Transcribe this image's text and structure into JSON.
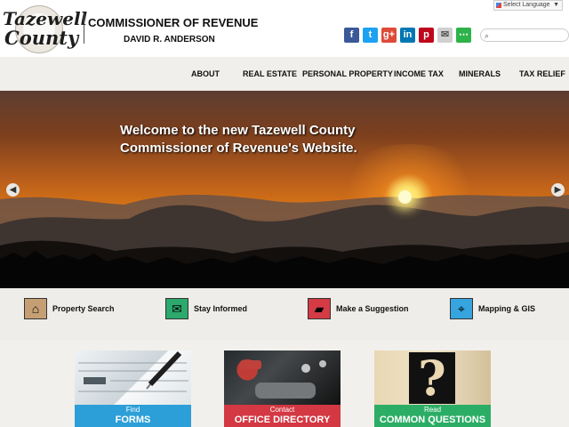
{
  "header": {
    "logo_line1": "Tazewell",
    "logo_line2": "County",
    "title": "COMMISSIONER OF REVENUE",
    "subtitle": "DAVID R. ANDERSON",
    "language_selector": "Select Language",
    "language_arrow": "▼",
    "social": [
      {
        "icon": "facebook-icon",
        "glyph": "f",
        "color": "#3b5998"
      },
      {
        "icon": "twitter-icon",
        "glyph": "t",
        "color": "#1da1f2"
      },
      {
        "icon": "google-plus-icon",
        "glyph": "g+",
        "color": "#dd4b39"
      },
      {
        "icon": "linkedin-icon",
        "glyph": "in",
        "color": "#0077b5"
      },
      {
        "icon": "pinterest-icon",
        "glyph": "p",
        "color": "#bd081c"
      },
      {
        "icon": "email-icon",
        "glyph": "✉",
        "color": "#d0d0d0"
      },
      {
        "icon": "share-icon",
        "glyph": "⋯",
        "color": "#2db34a"
      }
    ],
    "search_placeholder": "",
    "search_icon": "⌕"
  },
  "nav": {
    "items": [
      "ABOUT",
      "REAL ESTATE",
      "PERSONAL PROPERTY",
      "INCOME TAX",
      "MINERALS",
      "TAX RELIEF"
    ]
  },
  "hero": {
    "title": "Welcome to the new Tazewell County Commissioner of Revenue's Website.",
    "prev_label": "◀",
    "next_label": "▶"
  },
  "quick_links": [
    {
      "label": "Property Search",
      "icon": "home-icon",
      "glyph": "⌂",
      "color": "#c59f73"
    },
    {
      "label": "Stay Informed",
      "icon": "envelope-icon",
      "glyph": "✉",
      "color": "#2ca96c"
    },
    {
      "label": "Make a Suggestion",
      "icon": "chat-icon",
      "glyph": "▰",
      "color": "#d43b45"
    },
    {
      "label": "Mapping & GIS",
      "icon": "map-icon",
      "glyph": "⌖",
      "color": "#36a4df"
    }
  ],
  "cards": [
    {
      "small": "Find",
      "big": "FORMS",
      "color": "#2c9fd8"
    },
    {
      "small": "Contact",
      "big": "OFFICE DIRECTORY",
      "color": "#d33843"
    },
    {
      "small": "Read",
      "big": "COMMON QUESTIONS",
      "color": "#2cad66"
    }
  ],
  "card_question_glyph": "?"
}
